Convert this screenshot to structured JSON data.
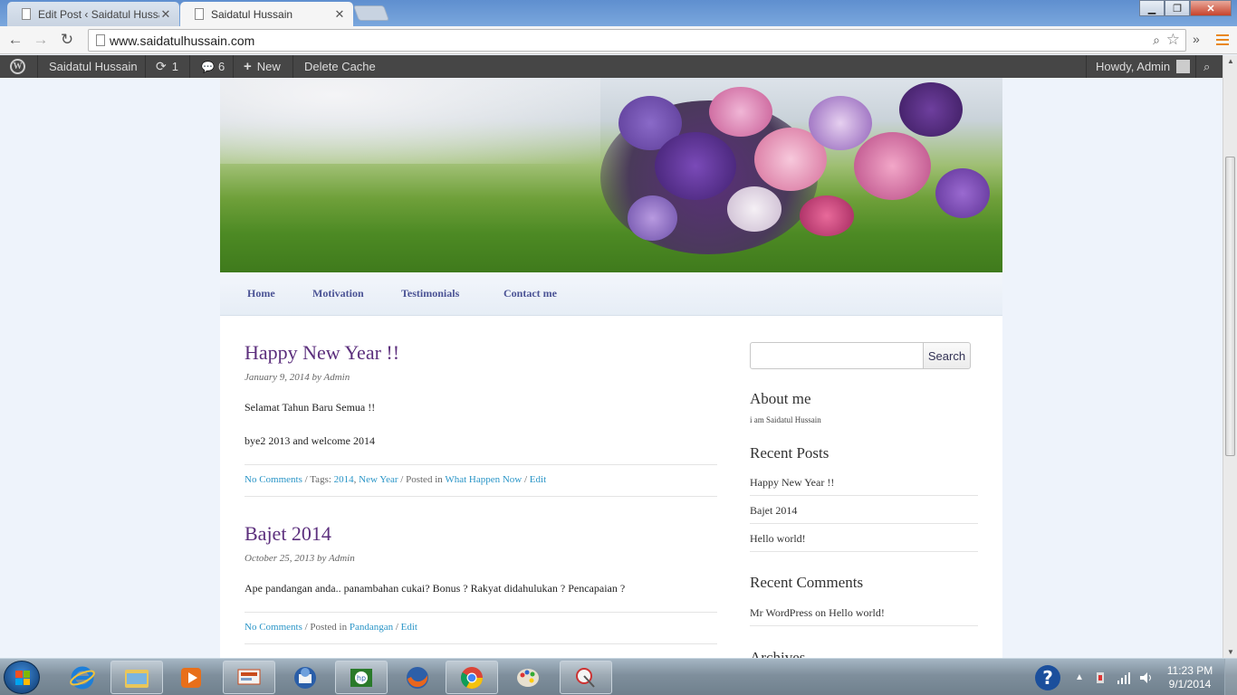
{
  "browser": {
    "tabs": [
      {
        "title": "Edit Post ‹ Saidatul Hussai",
        "active": false
      },
      {
        "title": "Saidatul Hussain",
        "active": true
      }
    ],
    "url": "www.saidatulhussain.com"
  },
  "adminbar": {
    "site_name": "Saidatul Hussain",
    "updates_count": "1",
    "comments_count": "6",
    "new_label": "New",
    "delete_cache_label": "Delete Cache",
    "howdy": "Howdy, Admin"
  },
  "nav": {
    "items": [
      "Home",
      "Motivation",
      "Testimonials",
      "Contact me"
    ]
  },
  "posts": [
    {
      "title": "Happy New Year !!",
      "meta": "January 9, 2014 by Admin",
      "paragraphs": [
        "Selamat Tahun Baru Semua !!",
        "bye2 2013 and welcome 2014"
      ],
      "footer": {
        "comments": "No Comments",
        "tags_label": " / Tags: ",
        "tag1": "2014",
        "tag_sep": ", ",
        "tag2": "New Year",
        "posted_in": " / Posted in ",
        "category": "What Happen Now",
        "sep": " / ",
        "edit": "Edit"
      }
    },
    {
      "title": "Bajet 2014",
      "meta": "October 25, 2013 by Admin",
      "paragraphs": [
        "Ape pandangan anda.. panambahan cukai? Bonus ? Rakyat didahulukan ? Pencapaian ?"
      ],
      "footer": {
        "comments": "No Comments",
        "posted_in": " / Posted in ",
        "category": "Pandangan",
        "sep": " / ",
        "edit": "Edit"
      }
    }
  ],
  "sidebar": {
    "search_button": "Search",
    "about_title": "About me",
    "about_text": "i am Saidatul Hussain",
    "recent_posts_title": "Recent Posts",
    "recent_posts": [
      "Happy New Year !!",
      "Bajet 2014",
      "Hello world!"
    ],
    "recent_comments_title": "Recent Comments",
    "recent_comment_author": "Mr WordPress",
    "recent_comment_on": " on ",
    "recent_comment_post": "Hello world!",
    "archives_title": "Archives"
  },
  "taskbar": {
    "time": "11:23 PM",
    "date": "9/1/2014"
  }
}
